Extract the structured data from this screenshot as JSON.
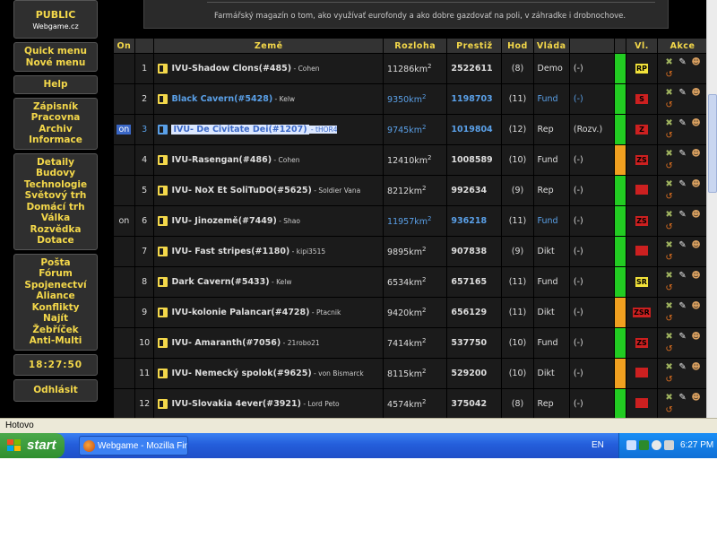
{
  "sidebar": {
    "brand_title": "PUBLIC",
    "brand_sub": "Webgame.cz",
    "groups": [
      [
        "Quick menu",
        "Nové menu"
      ],
      [
        "Help"
      ],
      [
        "Zápisník",
        "Pracovna",
        "Archiv",
        "Informace"
      ],
      [
        "Detaily",
        "Budovy",
        "Technologie",
        "Světový trh",
        "Domácí trh",
        "Válka",
        "Rozvědka",
        "Dotace"
      ],
      [
        "Pošta",
        "Fórum",
        "Spojenectví",
        "Aliance",
        "Konflikty",
        "Najít",
        "Žebříček",
        "Anti-Multi"
      ]
    ],
    "clock": "18:27:50",
    "logout": "Odhlásit"
  },
  "banner": {
    "text": "Farmářský magazín o tom, ako využívať eurofondy a ako dobre gazdovať na poli, v záhradke i drobnochove."
  },
  "table": {
    "headers": {
      "on": "On",
      "zeme": "Země",
      "rozloha": "Rozloha",
      "prestiz": "Prestiž",
      "hod": "Hod",
      "vlada": "Vláda",
      "vl": "Vl.",
      "akce": "Akce"
    },
    "area_unit": "km",
    "area_exp": "2",
    "rows": [
      {
        "on": "",
        "rank": "1",
        "name": "IVU-Shadow Clons(#485)",
        "owner": "Cohen",
        "area": "11286",
        "prestige": "2522611",
        "hod": "(8)",
        "gov": "Demo",
        "status": "(-)",
        "bar": "#22cc22",
        "badge": "RP",
        "badge_bg": "#f2e23a",
        "badge_fg": "#000000"
      },
      {
        "on": "",
        "rank": "2",
        "name": "Black Cavern(#5428)",
        "owner": "Kelw",
        "area": "9350",
        "prestige": "1198703",
        "hod": "(11)",
        "gov": "Fund",
        "status": "(-)",
        "bar": "#22cc22",
        "badge": "S",
        "badge_bg": "#cc2020",
        "badge_fg": "#000000"
      },
      {
        "on": "on",
        "rank": "3",
        "name": "IVU- De Civitate Dei(#1207)",
        "owner": "tHOR4",
        "area": "9745",
        "prestige": "1019804",
        "hod": "(12)",
        "gov": "Rep",
        "status": "(Rozv.)",
        "bar": "#22cc22",
        "badge": "Z",
        "badge_bg": "#cc2020",
        "badge_fg": "#000000"
      },
      {
        "on": "",
        "rank": "4",
        "name": "IVU-Rasengan(#486)",
        "owner": "Cohen",
        "area": "12410",
        "prestige": "1008589",
        "hod": "(10)",
        "gov": "Fund",
        "status": "(-)",
        "bar": "#f0a020",
        "badge": "ZS",
        "badge_bg": "#cc2020",
        "badge_fg": "#000000"
      },
      {
        "on": "",
        "rank": "5",
        "name": "IVU- NoX Et SoliTuDO(#5625)",
        "owner": "Soldier Vana",
        "area": "8212",
        "prestige": "992634",
        "hod": "(9)",
        "gov": "Rep",
        "status": "(-)",
        "bar": "#22cc22",
        "badge": "",
        "badge_bg": "#cc2020",
        "badge_fg": "#000000"
      },
      {
        "on": "on",
        "rank": "6",
        "name": "IVU- Jinozemě(#7449)",
        "owner": "Shao",
        "area": "11957",
        "prestige": "936218",
        "hod": "(11)",
        "gov": "Fund",
        "status": "(-)",
        "bar": "#22cc22",
        "badge": "ZS",
        "badge_bg": "#cc2020",
        "badge_fg": "#000000"
      },
      {
        "on": "",
        "rank": "7",
        "name": "IVU- Fast stripes(#1180)",
        "owner": "kipi3515",
        "area": "9895",
        "prestige": "907838",
        "hod": "(9)",
        "gov": "Dikt",
        "status": "(-)",
        "bar": "#22cc22",
        "badge": "",
        "badge_bg": "#cc2020",
        "badge_fg": "#000000"
      },
      {
        "on": "",
        "rank": "8",
        "name": "Dark Cavern(#5433)",
        "owner": "Kelw",
        "area": "6534",
        "prestige": "657165",
        "hod": "(11)",
        "gov": "Fund",
        "status": "(-)",
        "bar": "#22cc22",
        "badge": "SR",
        "badge_bg": "#f2e23a",
        "badge_fg": "#000000"
      },
      {
        "on": "",
        "rank": "9",
        "name": "IVU-kolonie Palancar(#4728)",
        "owner": "Ptacnik",
        "area": "9420",
        "prestige": "656129",
        "hod": "(11)",
        "gov": "Dikt",
        "status": "(-)",
        "bar": "#f0a020",
        "badge": "ZSR",
        "badge_bg": "#cc2020",
        "badge_fg": "#000000"
      },
      {
        "on": "",
        "rank": "10",
        "name": "IVU- Amaranth(#7056)",
        "owner": "21robo21",
        "area": "7414",
        "prestige": "537750",
        "hod": "(10)",
        "gov": "Fund",
        "status": "(-)",
        "bar": "#22cc22",
        "badge": "ZS",
        "badge_bg": "#cc2020",
        "badge_fg": "#000000"
      },
      {
        "on": "",
        "rank": "11",
        "name": "IVU- Nemecký spolok(#9625)",
        "owner": "von Bismarck",
        "area": "8115",
        "prestige": "529200",
        "hod": "(10)",
        "gov": "Dikt",
        "status": "(-)",
        "bar": "#f0a020",
        "badge": "",
        "badge_bg": "#cc2020",
        "badge_fg": "#000000"
      },
      {
        "on": "",
        "rank": "12",
        "name": "IVU-Slovakia 4ever(#3921)",
        "owner": "Lord Peto",
        "area": "4574",
        "prestige": "375042",
        "hod": "(8)",
        "gov": "Rep",
        "status": "(-)",
        "bar": "#22cc22",
        "badge": "",
        "badge_bg": "#cc2020",
        "badge_fg": "#000000"
      }
    ]
  },
  "statusbar": {
    "text": "Hotovo"
  },
  "taskbar": {
    "start": "start",
    "item": "Webgame - Mozilla Fir...",
    "lang": "EN",
    "time": "6:27 PM"
  },
  "colors": {
    "accent": "#f4d84a",
    "link_blue": "#5aa0e8",
    "bar_green": "#22cc22",
    "bar_orange": "#f0a020"
  },
  "icons": {
    "row_actions": [
      "attack-icon",
      "edit-icon",
      "spy-icon",
      "trade-icon"
    ],
    "country_flag": "flag-icon"
  }
}
